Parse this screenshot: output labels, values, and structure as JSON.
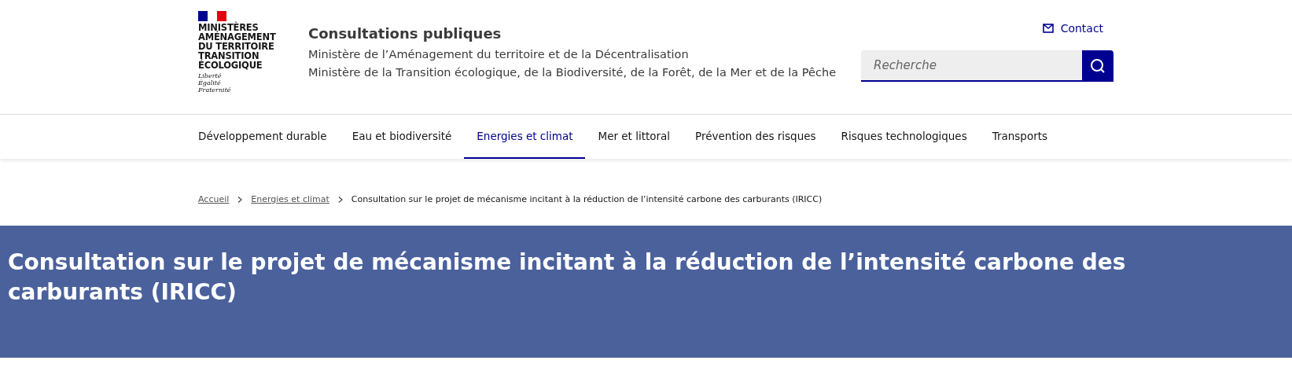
{
  "logo": {
    "ministry_lines": [
      "MINISTÈRES",
      "AMÉNAGEMENT",
      "DU TERRITOIRE",
      "TRANSITION",
      "ÉCOLOGIQUE"
    ],
    "motto": [
      "Liberté",
      "Égalité",
      "Fraternité"
    ]
  },
  "site": {
    "title": "Consultations publiques",
    "subtitles": [
      "Ministère de l’Aménagement du territoire et de la Décentralisation",
      "Ministère de la Transition écologique, de la Biodiversité, de la Forêt, de la Mer et de la Pêche"
    ]
  },
  "contact": "Contact",
  "search": {
    "placeholder": "Recherche"
  },
  "nav": [
    {
      "label": "Développement durable",
      "selected": false
    },
    {
      "label": "Eau et biodiversité",
      "selected": false
    },
    {
      "label": "Energies et climat",
      "selected": true
    },
    {
      "label": "Mer et littoral",
      "selected": false
    },
    {
      "label": "Prévention des risques",
      "selected": false
    },
    {
      "label": "Risques technologiques",
      "selected": false
    },
    {
      "label": "Transports",
      "selected": false
    }
  ],
  "breadcrumb": [
    {
      "label": "Accueil",
      "kind": "link"
    },
    {
      "label": "Energies et climat",
      "kind": "link"
    },
    {
      "label": "Consultation sur le projet de mécanisme incitant à la réduction de l’intensité carbone des carburants (IRICC)",
      "kind": "current"
    }
  ],
  "banner": {
    "title": "Consultation sur le projet de mécanisme incitant à la réduction de l’intensité carbone des carburants (IRICC)"
  }
}
